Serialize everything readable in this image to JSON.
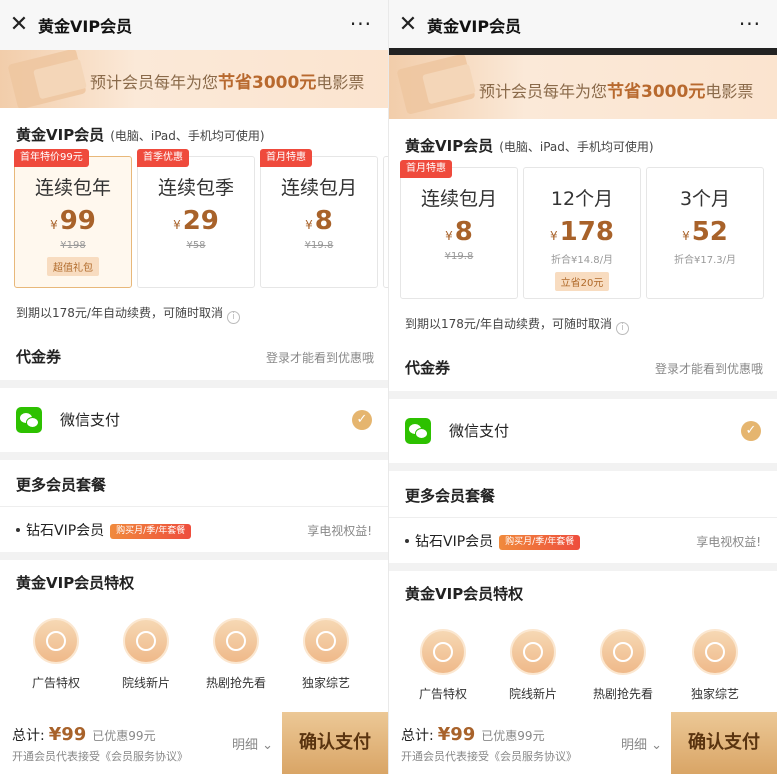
{
  "left": {
    "titlebar": {
      "close": "✕",
      "title": "黄金VIP会员",
      "more": "···"
    },
    "banner": {
      "pre": "预计会员每年为您",
      "highlight": "节省3000元",
      "post": "电影票"
    },
    "vip": {
      "title": "黄金VIP会员",
      "note": "(电脑、iPad、手机均可使用)"
    },
    "plans": [
      {
        "tag": "首年特价99元",
        "name": "连续包年",
        "currency": "¥",
        "price": "99",
        "orig": "¥198",
        "chip": "超值礼包"
      },
      {
        "tag": "首季优惠",
        "name": "连续包季",
        "currency": "¥",
        "price": "29",
        "orig": "¥58"
      },
      {
        "tag": "首月特惠",
        "name": "连续包月",
        "currency": "¥",
        "price": "8",
        "orig": "¥19.8"
      }
    ],
    "renew": "到期以178元/年自动续费，可随时取消",
    "coupon": {
      "label": "代金券",
      "hint": "登录才能看到优惠哦"
    },
    "payment": {
      "label": "微信支付",
      "check": "✓"
    },
    "more": {
      "label": "更多会员套餐",
      "item": "钻石VIP会员",
      "pill": "购买月/季/年套餐",
      "right": "享电视权益!"
    },
    "privileges": {
      "title": "黄金VIP会员特权",
      "items": [
        "广告特权",
        "院线新片",
        "热剧抢先看",
        "独家综艺"
      ]
    },
    "footer": {
      "total_label": "总计:",
      "total": "¥99",
      "discount": "已优惠99元",
      "agree": "开通会员代表接受《会员服务协议》",
      "detail": "明细",
      "confirm": "确认支付"
    }
  },
  "right": {
    "titlebar": {
      "close": "✕",
      "title": "黄金VIP会员",
      "more": "···"
    },
    "banner": {
      "pre": "预计会员每年为您",
      "highlight": "节省3000元",
      "post": "电影票"
    },
    "vip": {
      "title": "黄金VIP会员",
      "note": "(电脑、iPad、手机均可使用)"
    },
    "plans": [
      {
        "tag": "首月特惠",
        "name": "连续包月",
        "currency": "¥",
        "price": "8",
        "orig": "¥19.8"
      },
      {
        "name": "12个月",
        "currency": "¥",
        "price": "178",
        "orig": "折合¥14.8/月",
        "chip": "立省20元"
      },
      {
        "name": "3个月",
        "currency": "¥",
        "price": "52",
        "orig": "折合¥17.3/月"
      }
    ],
    "renew": "到期以178元/年自动续费，可随时取消",
    "coupon": {
      "label": "代金券",
      "hint": "登录才能看到优惠哦"
    },
    "payment": {
      "label": "微信支付",
      "check": "✓"
    },
    "more": {
      "label": "更多会员套餐",
      "item": "钻石VIP会员",
      "pill": "购买月/季/年套餐",
      "right": "享电视权益!"
    },
    "privileges": {
      "title": "黄金VIP会员特权",
      "items": [
        "广告特权",
        "院线新片",
        "热剧抢先看",
        "独家综艺"
      ]
    },
    "footer": {
      "total_label": "总计:",
      "total": "¥99",
      "discount": "已优惠99元",
      "agree": "开通会员代表接受《会员服务协议》",
      "detail": "明细",
      "confirm": "确认支付"
    }
  },
  "colors": {
    "gold_text": "#a8622a",
    "tag_red": "#ef4a3c",
    "wechat_green": "#2dc100",
    "check_gold": "#e5b56f"
  }
}
